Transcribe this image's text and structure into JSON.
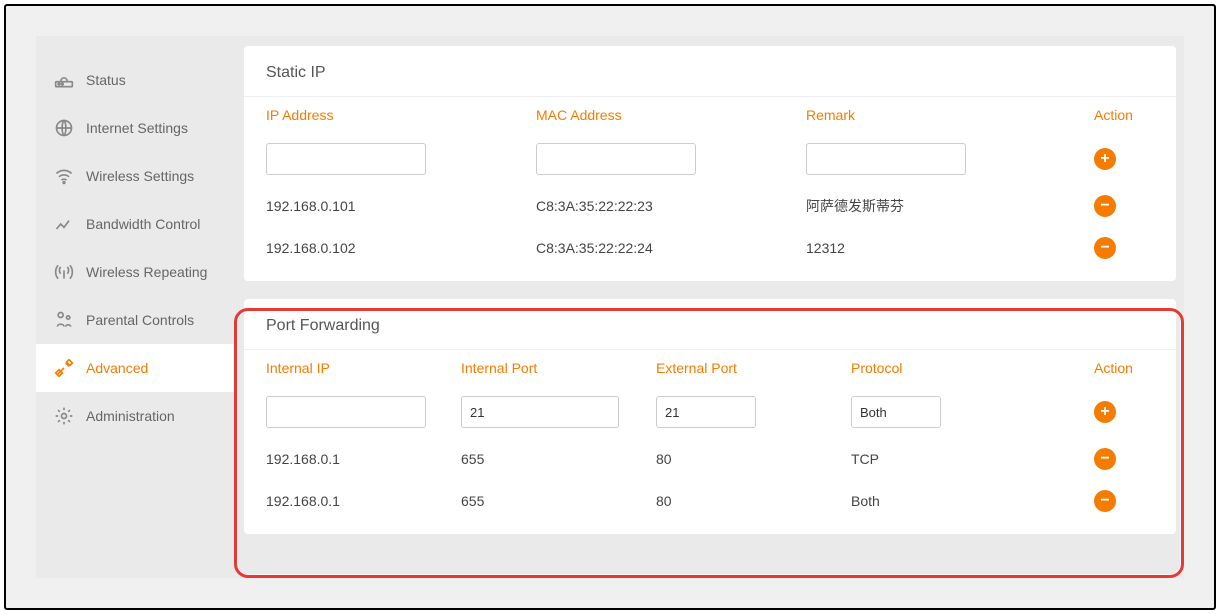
{
  "sidebar": {
    "items": [
      {
        "label": "Status"
      },
      {
        "label": "Internet Settings"
      },
      {
        "label": "Wireless Settings"
      },
      {
        "label": "Bandwidth Control"
      },
      {
        "label": "Wireless Repeating"
      },
      {
        "label": "Parental Controls"
      },
      {
        "label": "Advanced"
      },
      {
        "label": "Administration"
      }
    ]
  },
  "static_ip": {
    "title": "Static IP",
    "headers": {
      "ip": "IP Address",
      "mac": "MAC Address",
      "remark": "Remark",
      "action": "Action"
    },
    "inputs": {
      "ip": "",
      "mac": "",
      "remark": ""
    },
    "rows": [
      {
        "ip": "192.168.0.101",
        "mac": "C8:3A:35:22:22:23",
        "remark": "阿萨德发斯蒂芬"
      },
      {
        "ip": "192.168.0.102",
        "mac": "C8:3A:35:22:22:24",
        "remark": "12312"
      }
    ]
  },
  "port_forwarding": {
    "title": "Port Forwarding",
    "headers": {
      "iip": "Internal IP",
      "iport": "Internal Port",
      "eport": "External Port",
      "proto": "Protocol",
      "action": "Action"
    },
    "inputs": {
      "iip": "",
      "iport": "21",
      "eport": "21",
      "proto": "Both"
    },
    "rows": [
      {
        "iip": "192.168.0.1",
        "iport": "655",
        "eport": "80",
        "proto": "TCP"
      },
      {
        "iip": "192.168.0.1",
        "iport": "655",
        "eport": "80",
        "proto": "Both"
      }
    ]
  }
}
